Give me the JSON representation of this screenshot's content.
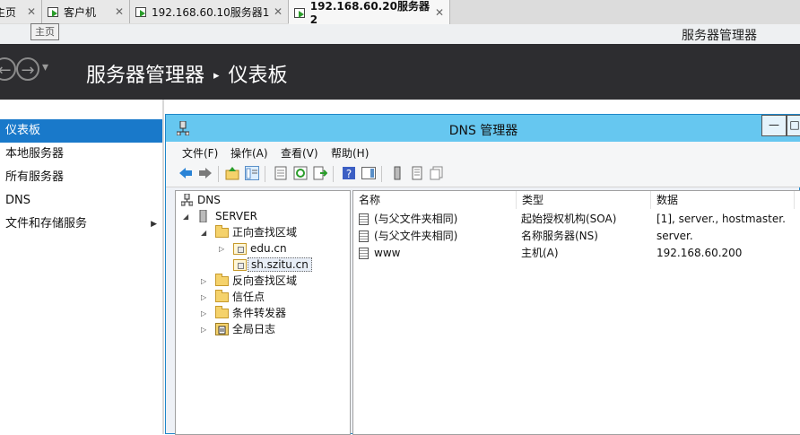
{
  "tabs": [
    {
      "label": "主页",
      "close": "✕"
    },
    {
      "label": "客户机",
      "close": "✕"
    },
    {
      "label": "192.168.60.10服务器1",
      "close": "✕"
    },
    {
      "label": "192.168.60.20服务器2",
      "close": "✕"
    }
  ],
  "tooltip": "主页",
  "server_manager": {
    "app_title": "服务器管理器",
    "breadcrumb_root": "服务器管理器",
    "breadcrumb_sep": "▸",
    "breadcrumb_page": "仪表板",
    "back_glyph": "←",
    "forward_glyph": "→",
    "history_glyph": "▾"
  },
  "sidebar": {
    "items": [
      {
        "label": "仪表板",
        "active": true
      },
      {
        "label": "本地服务器"
      },
      {
        "label": "所有服务器"
      },
      {
        "label": "DNS"
      },
      {
        "label": "文件和存储服务",
        "arrow": "▶"
      }
    ]
  },
  "dns_window": {
    "title": "DNS 管理器",
    "minimize": "—",
    "maximize": "□",
    "menus": [
      "文件(F)",
      "操作(A)",
      "查看(V)",
      "帮助(H)"
    ],
    "tree": {
      "root": "DNS",
      "server": "SERVER",
      "forward_zones": "正向查找区域",
      "zones": [
        "edu.cn",
        "sh.szitu.cn"
      ],
      "reverse_zones": "反向查找区域",
      "trust_points": "信任点",
      "conditional_forwarders": "条件转发器",
      "global_logs": "全局日志",
      "expanded_glyph": "◢",
      "collapsed_glyph": "▷"
    },
    "columns": [
      "名称",
      "类型",
      "数据"
    ],
    "records": [
      {
        "name": "(与父文件夹相同)",
        "type": "起始授权机构(SOA)",
        "data": "[1], server., hostmaster."
      },
      {
        "name": "(与父文件夹相同)",
        "type": "名称服务器(NS)",
        "data": "server."
      },
      {
        "name": "www",
        "type": "主机(A)",
        "data": "192.168.60.200"
      }
    ]
  },
  "colors": {
    "header_bg": "#2d2d30",
    "sidebar_active": "#1979ca",
    "dns_titlebar": "#66c7f0"
  }
}
